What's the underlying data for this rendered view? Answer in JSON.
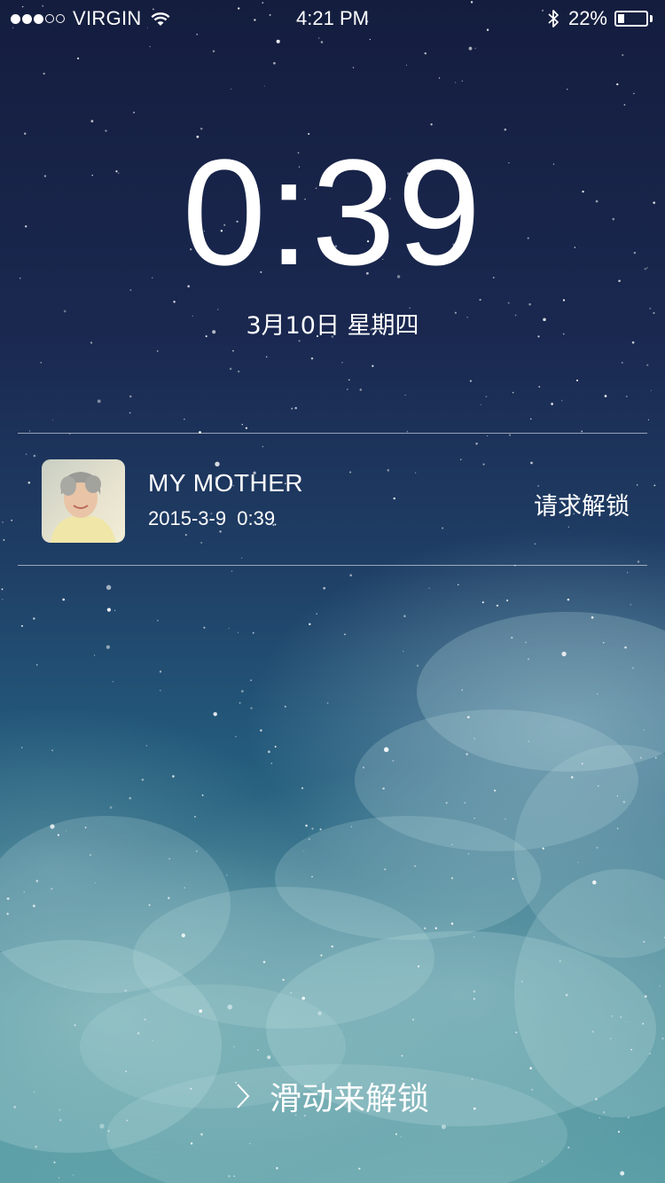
{
  "status_bar": {
    "signal_bars_filled": 3,
    "signal_bars_total": 5,
    "carrier": "VIRGIN",
    "time": "4:21 PM",
    "battery_percent": "22%",
    "battery_level": 0.22,
    "icons": [
      "wifi-icon",
      "bluetooth-icon",
      "battery-icon"
    ]
  },
  "lockscreen": {
    "clock": "0:39",
    "date": "3月10日 星期四"
  },
  "notification": {
    "title": "MY MOTHER",
    "timestamp": "2015-3-9  0:39",
    "action_label": "请求解锁",
    "avatar_icon": "contact-photo"
  },
  "unlock": {
    "label": "滑动来解锁",
    "icon": "chevron-right-icon"
  }
}
